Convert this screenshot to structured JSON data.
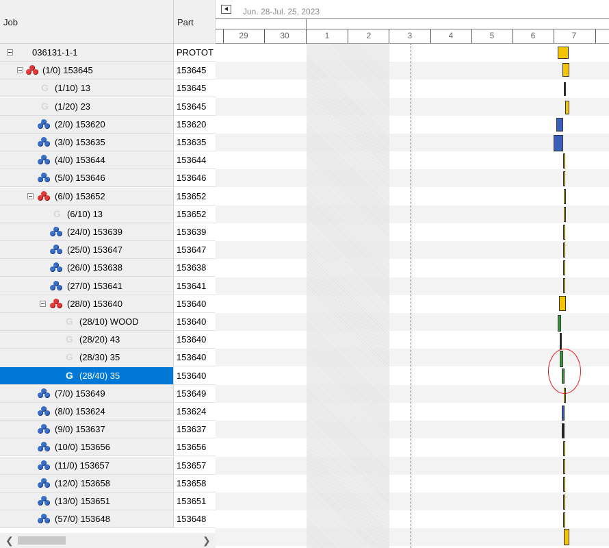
{
  "header": {
    "job_label": "Job",
    "part_label": "Part"
  },
  "gantt": {
    "date_range": "Jun. 28-Jul. 25, 2023",
    "days": [
      "29",
      "30",
      "1",
      "2",
      "3",
      "4",
      "5",
      "6",
      "7"
    ]
  },
  "rows": [
    {
      "job": "036131-1-1",
      "part": "PROTOT",
      "type": "root"
    },
    {
      "job": "(1/0) 153645",
      "part": "153645",
      "type": "red"
    },
    {
      "job": "(1/10) 13",
      "part": "153645",
      "type": "op"
    },
    {
      "job": "(1/20) 23",
      "part": "153645",
      "type": "op"
    },
    {
      "job": "(2/0) 153620",
      "part": "153620",
      "type": "blue"
    },
    {
      "job": "(3/0) 153635",
      "part": "153635",
      "type": "blue"
    },
    {
      "job": "(4/0) 153644",
      "part": "153644",
      "type": "blue"
    },
    {
      "job": "(5/0) 153646",
      "part": "153646",
      "type": "blue"
    },
    {
      "job": "(6/0) 153652",
      "part": "153652",
      "type": "red"
    },
    {
      "job": "(6/10) 13",
      "part": "153652",
      "type": "op"
    },
    {
      "job": "(24/0) 153639",
      "part": "153639",
      "type": "blue"
    },
    {
      "job": "(25/0) 153647",
      "part": "153647",
      "type": "blue"
    },
    {
      "job": "(26/0) 153638",
      "part": "153638",
      "type": "blue"
    },
    {
      "job": "(27/0) 153641",
      "part": "153641",
      "type": "blue"
    },
    {
      "job": "(28/0) 153640",
      "part": "153640",
      "type": "red"
    },
    {
      "job": "(28/10) WOOD",
      "part": "153640",
      "type": "op"
    },
    {
      "job": "(28/20) 43",
      "part": "153640",
      "type": "op"
    },
    {
      "job": "(28/30) 35",
      "part": "153640",
      "type": "op"
    },
    {
      "job": "(28/40) 35",
      "part": "153640",
      "type": "op",
      "selected": true
    },
    {
      "job": "(7/0) 153649",
      "part": "153649",
      "type": "blue"
    },
    {
      "job": "(8/0) 153624",
      "part": "153624",
      "type": "blue"
    },
    {
      "job": "(9/0) 153637",
      "part": "153637",
      "type": "blue"
    },
    {
      "job": "(10/0) 153656",
      "part": "153656",
      "type": "blue"
    },
    {
      "job": "(11/0) 153657",
      "part": "153657",
      "type": "blue"
    },
    {
      "job": "(12/0) 153658",
      "part": "153658",
      "type": "blue"
    },
    {
      "job": "(13/0) 153651",
      "part": "153651",
      "type": "blue"
    },
    {
      "job": "(57/0) 153648",
      "part": "153648",
      "type": "blue"
    }
  ],
  "colors": {
    "selection": "#0078d7",
    "assembly_red": "#e23a3a",
    "assembly_blue": "#3a6fc8",
    "bar_yellow": "#f5c400",
    "bar_green": "#3a9a3a",
    "annotation": "#e21b1b"
  }
}
